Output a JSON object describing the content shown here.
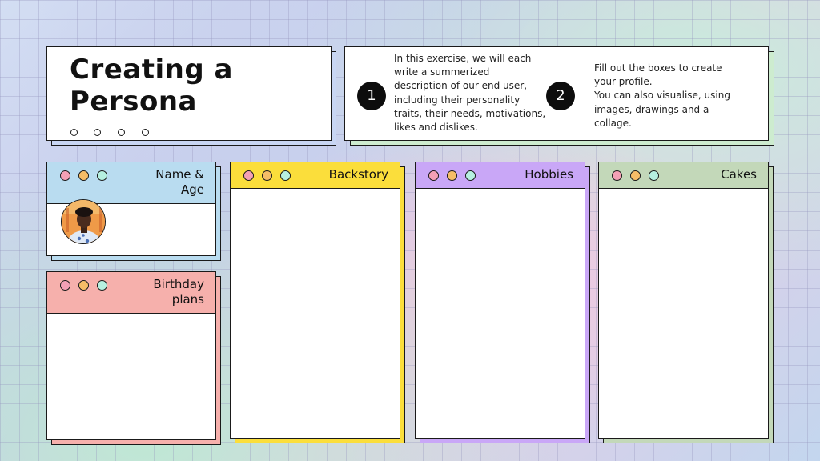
{
  "title": {
    "line1": "Creating a",
    "line2": "Persona"
  },
  "steps": [
    {
      "number": "1",
      "text": "In this exercise, we will each\nwrite a summerized\ndescription of our end user,\nincluding their personality\ntraits, their needs, motivations,\nlikes and dislikes."
    },
    {
      "number": "2",
      "text": "Fill out the boxes to create\nyour profile.\nYou can also visualise, using\nimages, drawings and a\ncollage."
    }
  ],
  "sections": {
    "name_age": {
      "title": "Name &\nAge"
    },
    "birthday": {
      "title": "Birthday\nplans"
    },
    "backstory": {
      "title": "Backstory"
    },
    "hobbies": {
      "title": "Hobbies"
    },
    "cakes": {
      "title": "Cakes"
    }
  },
  "colors": {
    "name_age": "#b9dcf0",
    "birthday": "#f6b0ac",
    "backstory": "#fbde3b",
    "hobbies": "#c9a7f7",
    "cakes": "#c3d8b9",
    "title_shadow": "#c8d6f3",
    "steps_shadow": "#cdeccf",
    "dot_pink": "#f3a0b5",
    "dot_orange": "#f6bd67",
    "dot_mint": "#b6f0e0"
  }
}
